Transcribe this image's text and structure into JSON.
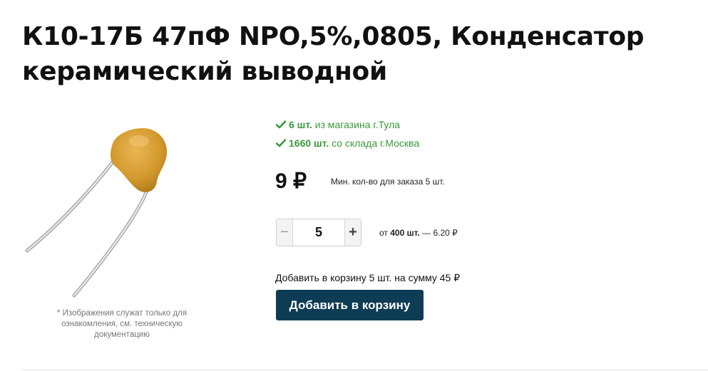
{
  "product": {
    "title": "К10-17Б 47пФ NPO,5%,0805, Конденсатор керамический выводной",
    "image_note": "* Изображения служат только для ознакомления, см. техническую документацию"
  },
  "stock": [
    {
      "qty": "6 шт.",
      "source": "из магазина г.Тула",
      "icon": "check-icon"
    },
    {
      "qty": "1660 шт.",
      "source": "со склада г.Москва",
      "icon": "check-icon"
    }
  ],
  "price": {
    "value": "9 ₽",
    "min_order": "Мин. кол-во для заказа 5 шт."
  },
  "quantity": {
    "value": "5",
    "minus": "−",
    "plus": "+"
  },
  "bulk": {
    "from": "от",
    "qty": "400 шт.",
    "price": "— 6.20 ₽"
  },
  "cart": {
    "summary": "Добавить в корзину 5 шт. на сумму 45 ₽",
    "button_label": "Добавить в корзину"
  },
  "colors": {
    "in_stock": "#3a9a3a",
    "button_bg": "#0d3c54",
    "capacitor_body": "#d49a2e"
  }
}
